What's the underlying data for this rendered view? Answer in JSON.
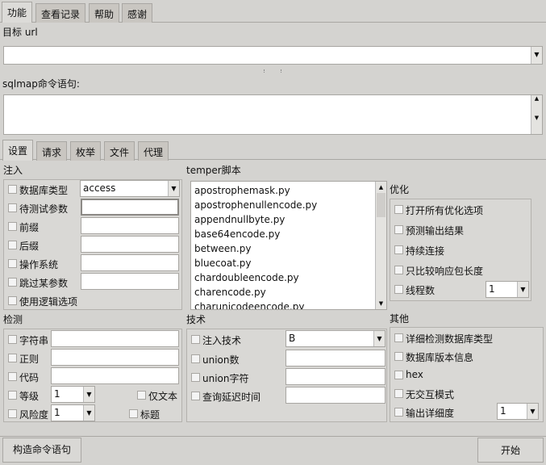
{
  "top_tabs": [
    "功能",
    "查看记录",
    "帮助",
    "感谢"
  ],
  "target_url": {
    "label": "目标 url",
    "value": ""
  },
  "sqlmap_cmd": {
    "label": "sqlmap命令语句:",
    "value": ""
  },
  "inner_tabs": [
    "设置",
    "请求",
    "枚举",
    "文件",
    "代理"
  ],
  "injection": {
    "title": "注入",
    "db_type_label": "数据库类型",
    "db_type_value": "access",
    "rows": [
      "待测试参数",
      "前缀",
      "后缀",
      "操作系统",
      "跳过某参数"
    ],
    "logic_label": "使用逻辑选项"
  },
  "temper": {
    "title": "temper脚本",
    "items": [
      "apostrophemask.py",
      "apostrophenullencode.py",
      "appendnullbyte.py",
      "base64encode.py",
      "between.py",
      "bluecoat.py",
      "chardoubleencode.py",
      "charencode.py",
      "charunicodeencode.py"
    ]
  },
  "optimize": {
    "title": "优化",
    "items": [
      "打开所有优化选项",
      "预测输出结果",
      "持续连接",
      "只比较响应包长度"
    ],
    "threads_label": "线程数",
    "threads_value": "1"
  },
  "detect": {
    "title": "检测",
    "rows": [
      "字符串",
      "正则",
      "代码"
    ],
    "level_label": "等级",
    "level_value": "1",
    "text_only_label": "仅文本",
    "risk_label": "风险度",
    "risk_value": "1",
    "title_label": "标题"
  },
  "technique": {
    "title": "技术",
    "tech_label": "注入技术",
    "tech_value": "B",
    "rows": [
      "union数",
      "union字符",
      "查询延迟时间"
    ]
  },
  "other": {
    "title": "其他",
    "items": [
      "详细检测数据库类型",
      "数据库版本信息",
      "hex",
      "无交互模式"
    ],
    "verbose_label": "输出详细度",
    "verbose_value": "1"
  },
  "bottom": {
    "build_label": "构造命令语句",
    "start_label": "开始"
  }
}
